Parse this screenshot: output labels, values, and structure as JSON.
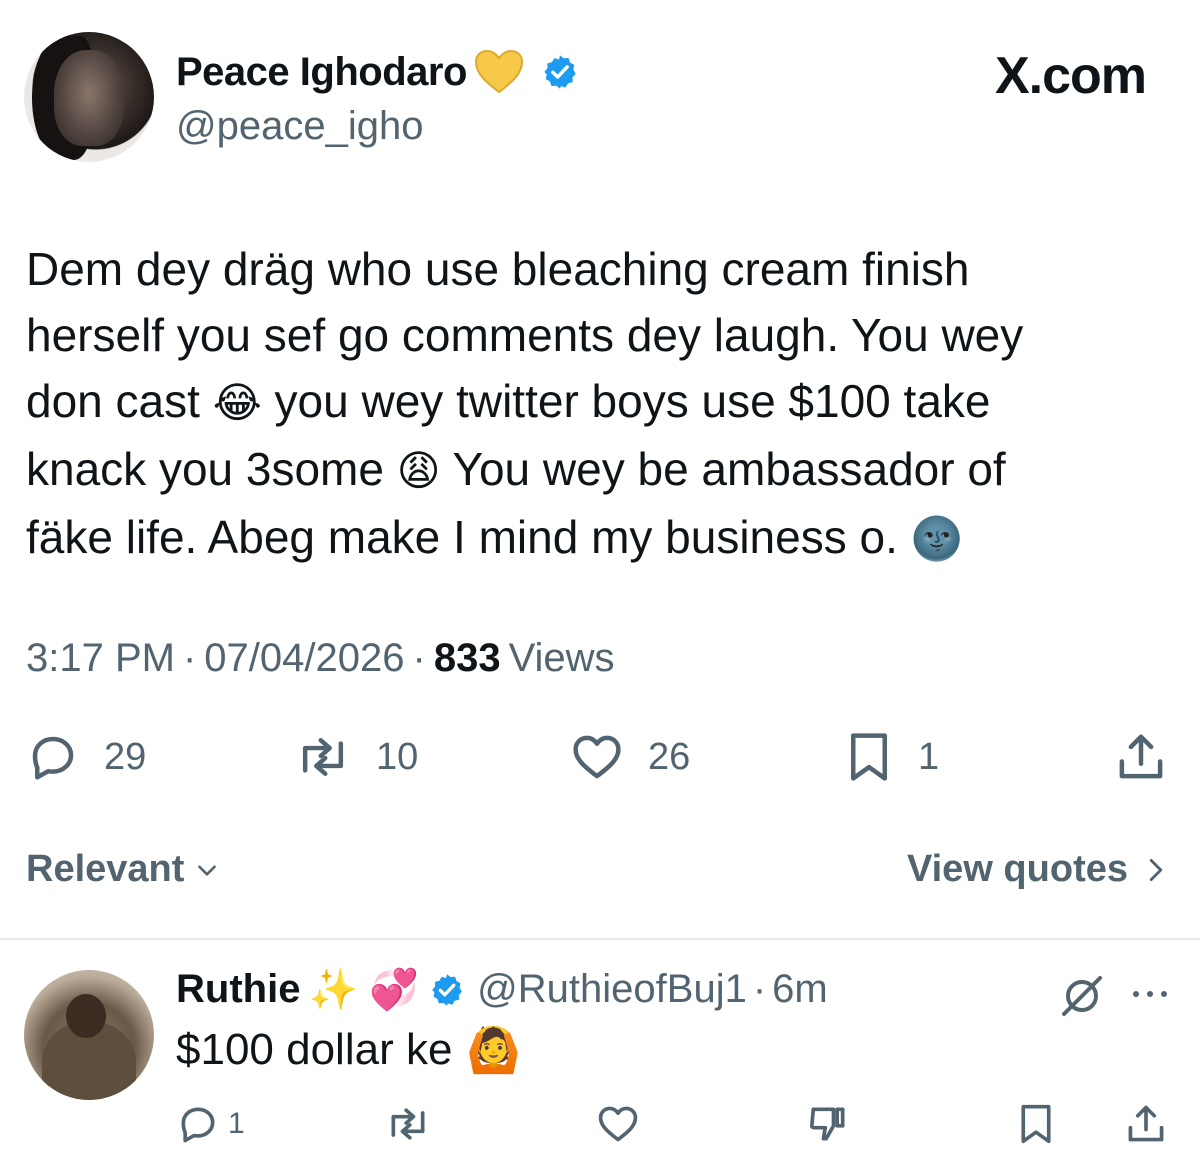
{
  "tweet": {
    "display_name": "Peace Ighodaro",
    "handle": "@peace_igho",
    "text_lines": [
      "Dem dey dräg who use bleaching cream finish",
      "herself you sef go comments dey laugh. You wey",
      "don cast",
      "you wey twitter boys use $100 take",
      "knack you 3some",
      "You wey be ambassador of",
      "fäke life. Abeg make I mind my business o."
    ],
    "emojis": {
      "laugh": "😂",
      "weary": "😩",
      "moon": "🌚"
    },
    "time": "3:17 PM",
    "date": "07/04/2026",
    "views_count": "833",
    "views_label": "Views",
    "stats": {
      "replies": "29",
      "reposts": "10",
      "likes": "26",
      "bookmarks": "1"
    }
  },
  "site_logo": "X.com",
  "sort": {
    "label": "Relevant"
  },
  "quotes": {
    "label": "View quotes"
  },
  "reply": {
    "name": "Ruthie",
    "name_emojis": "✨ 💞",
    "handle": "@RuthieofBuj1",
    "time": "6m",
    "text": "$100 dollar ke",
    "text_emoji": "🙆",
    "stats": {
      "replies": "1"
    }
  },
  "colors": {
    "verified": "#1d9bf0",
    "secondary_text": "#536471",
    "primary_text": "#0f1419",
    "heart_gold": "#f7c948"
  }
}
